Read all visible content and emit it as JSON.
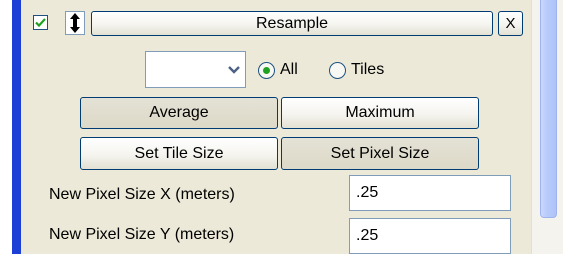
{
  "panel": {
    "title_button": "Resample",
    "close_label": "X",
    "enabled": true,
    "dropdown": {
      "value": ""
    },
    "scope": {
      "options": [
        "All",
        "Tiles"
      ],
      "selected": "All"
    },
    "method_buttons": {
      "average": "Average",
      "maximum": "Maximum",
      "selected": "Average"
    },
    "size_buttons": {
      "tile_size": "Set Tile Size",
      "pixel_size": "Set Pixel Size",
      "selected": "Set Pixel Size"
    },
    "fields": {
      "pixel_x": {
        "label": "New Pixel Size X (meters)",
        "value": ".25"
      },
      "pixel_y": {
        "label": "New Pixel Size Y (meters)",
        "value": ".25"
      }
    }
  },
  "colors": {
    "panel_bg": "#ece9d8",
    "frame_blue": "#1c3fd6",
    "check_green": "#21a121",
    "button_border": "#003c74"
  },
  "icons": {
    "checkbox": "checkmark-icon",
    "reorder": "up-down-arrow-icon",
    "dropdown": "chevron-down-icon"
  }
}
